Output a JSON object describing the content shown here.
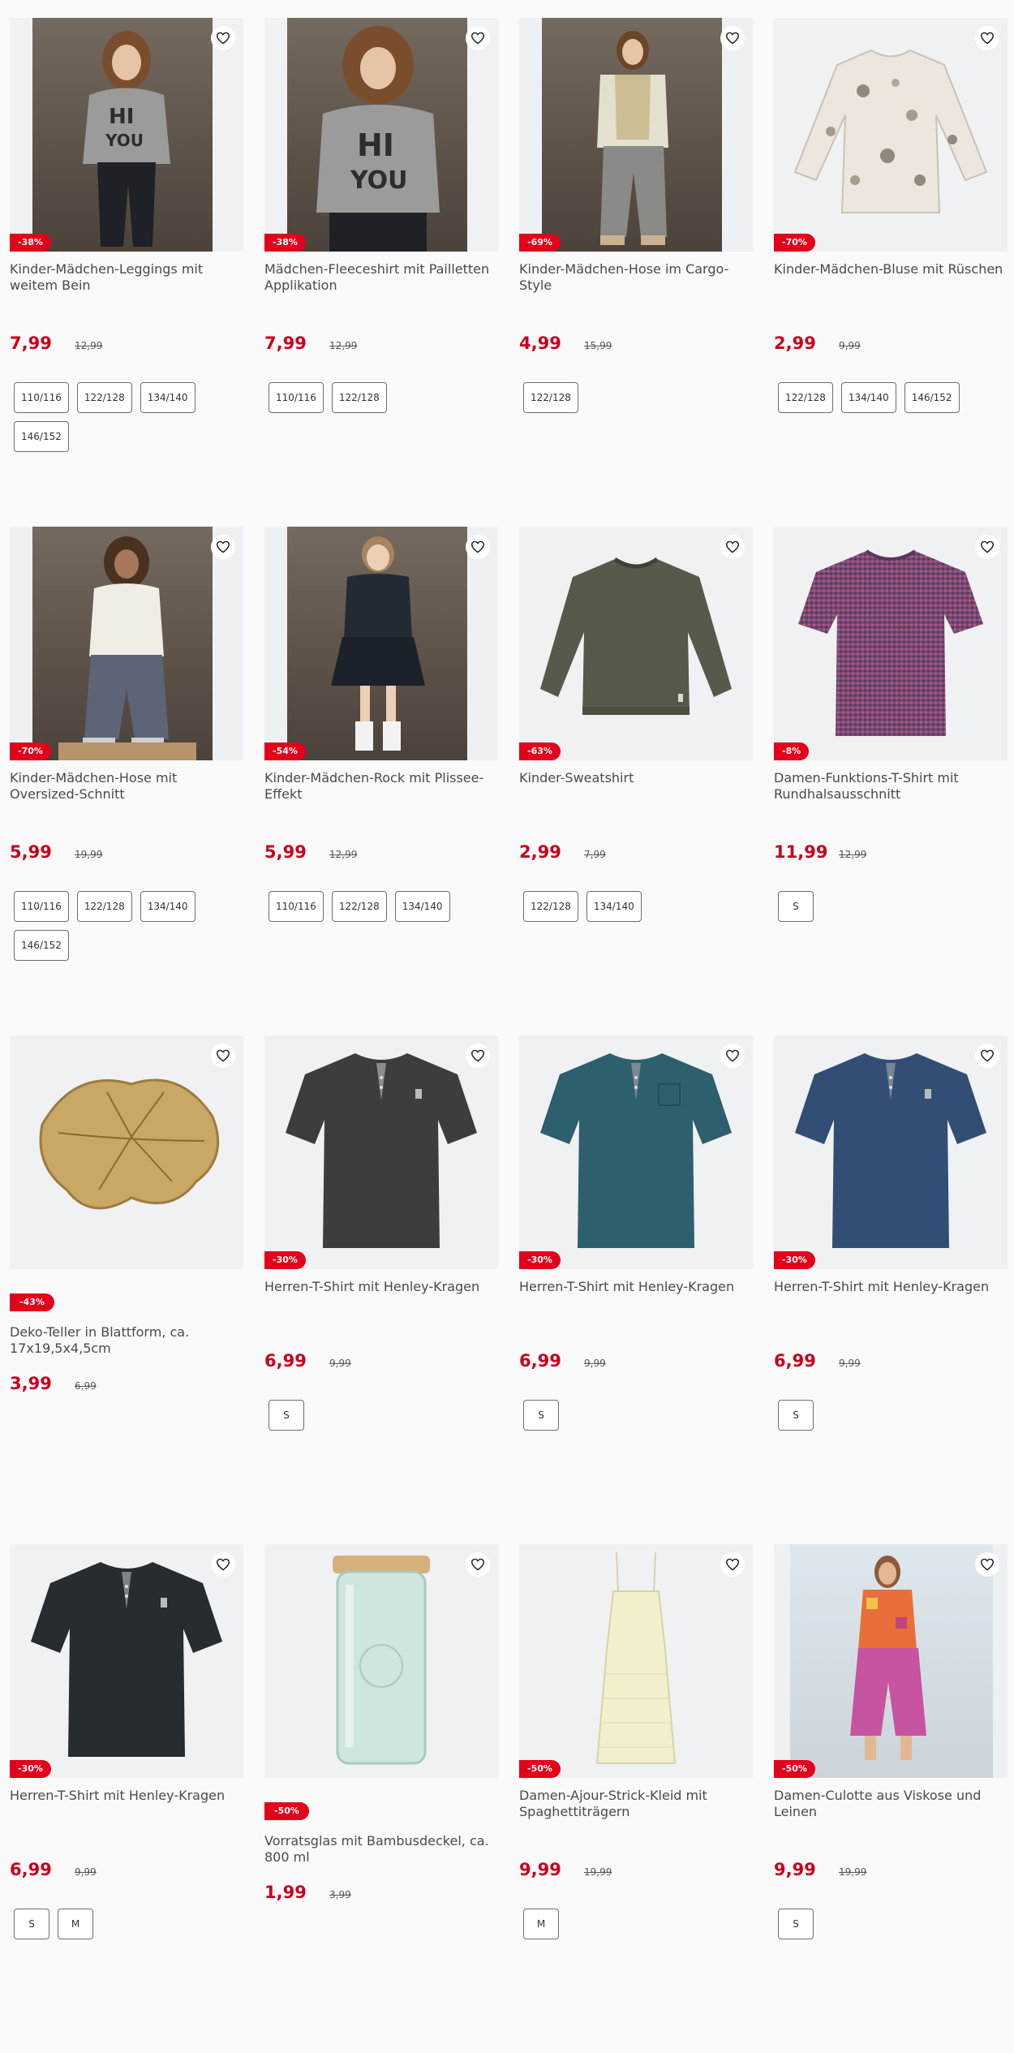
{
  "products": [
    {
      "title": "Kinder-Mädchen-Leggings mit weitem Bein",
      "price": "7,99",
      "old_price": "12,99",
      "discount": "-38%",
      "image_icon": "girl-sweater-photo",
      "sizes": [
        "110/116",
        "122/128",
        "134/140",
        "146/152"
      ]
    },
    {
      "title": "Mädchen-Fleeceshirt mit Pailletten Applikation",
      "price": "7,99",
      "old_price": "12,99",
      "discount": "-38%",
      "image_icon": "girl-sweater-photo",
      "sizes": [
        "110/116",
        "122/128"
      ]
    },
    {
      "title": "Kinder-Mädchen-Hose im Cargo-Style",
      "price": "4,99",
      "old_price": "15,99",
      "discount": "-69%",
      "image_icon": "girl-cargo-photo",
      "sizes": [
        "122/128"
      ]
    },
    {
      "title": "Kinder-Mädchen-Bluse mit Rüschen",
      "price": "2,99",
      "old_price": "9,99",
      "discount": "-70%",
      "image_icon": "blouse-icon",
      "sizes": [
        "122/128",
        "134/140",
        "146/152"
      ]
    },
    {
      "title": "Kinder-Mädchen-Hose mit Oversized-Schnitt",
      "price": "5,99",
      "old_price": "19,99",
      "discount": "-70%",
      "image_icon": "girl-fleece-photo",
      "sizes": [
        "110/116",
        "122/128",
        "134/140",
        "146/152"
      ]
    },
    {
      "title": "Kinder-Mädchen-Rock mit Plissee-Effekt",
      "price": "5,99",
      "old_price": "12,99",
      "discount": "-54%",
      "image_icon": "girl-skirt-photo",
      "sizes": [
        "110/116",
        "122/128",
        "134/140"
      ]
    },
    {
      "title": "Kinder-Sweatshirt",
      "price": "2,99",
      "old_price": "7,99",
      "discount": "-63%",
      "image_icon": "sweatshirt-icon",
      "sizes": [
        "122/128",
        "134/140"
      ]
    },
    {
      "title": "Damen-Funktions-T-Shirt mit Rundhalsausschnitt",
      "price": "11,99",
      "old_price": "12,99",
      "discount": "-8%",
      "image_icon": "tshirt-icon",
      "sizes": [
        "S"
      ]
    },
    {
      "title": "Deko-Teller in Blattform, ca. 17x19,5x4,5cm",
      "price": "3,99",
      "old_price": "6,99",
      "discount": "-43%",
      "image_icon": "leaf-plate-icon",
      "sizes": []
    },
    {
      "title": "Herren-T-Shirt mit Henley-Kragen",
      "price": "6,99",
      "old_price": "9,99",
      "discount": "-30%",
      "image_icon": "henley-shirt-icon",
      "sizes": [
        "S"
      ]
    },
    {
      "title": "Herren-T-Shirt mit Henley-Kragen",
      "price": "6,99",
      "old_price": "9,99",
      "discount": "-30%",
      "image_icon": "henley-shirt-icon",
      "sizes": [
        "S"
      ]
    },
    {
      "title": "Herren-T-Shirt mit Henley-Kragen",
      "price": "6,99",
      "old_price": "9,99",
      "discount": "-30%",
      "image_icon": "henley-shirt-icon",
      "sizes": [
        "S"
      ]
    },
    {
      "title": "Herren-T-Shirt mit Henley-Kragen",
      "price": "6,99",
      "old_price": "9,99",
      "discount": "-30%",
      "image_icon": "henley-shirt-icon",
      "sizes": [
        "S",
        "M"
      ]
    },
    {
      "title": "Vorratsglas mit Bambusdeckel, ca. 800 ml",
      "price": "1,99",
      "old_price": "3,99",
      "discount": "-50%",
      "image_icon": "storage-jar-icon",
      "sizes": []
    },
    {
      "title": "Damen-Ajour-Strick-Kleid mit Spaghettiträgern",
      "price": "9,99",
      "old_price": "19,99",
      "discount": "-50%",
      "image_icon": "dress-icon",
      "sizes": [
        "M"
      ]
    },
    {
      "title": "Damen-Culotte aus Viskose und Leinen",
      "price": "9,99",
      "old_price": "19,99",
      "discount": "-50%",
      "image_icon": "woman-culotte-photo",
      "sizes": [
        "S"
      ]
    }
  ],
  "colors": {
    "price": "#c8001e",
    "badge": "#e2001a",
    "tshirt_purple": "#7a4a78",
    "henley_charcoal": "#3c3d3e",
    "henley_teal": "#2e5f6c",
    "henley_navy": "#324e74",
    "henley_black": "#262c30",
    "sweatshirt_olive": "#565a4a"
  }
}
